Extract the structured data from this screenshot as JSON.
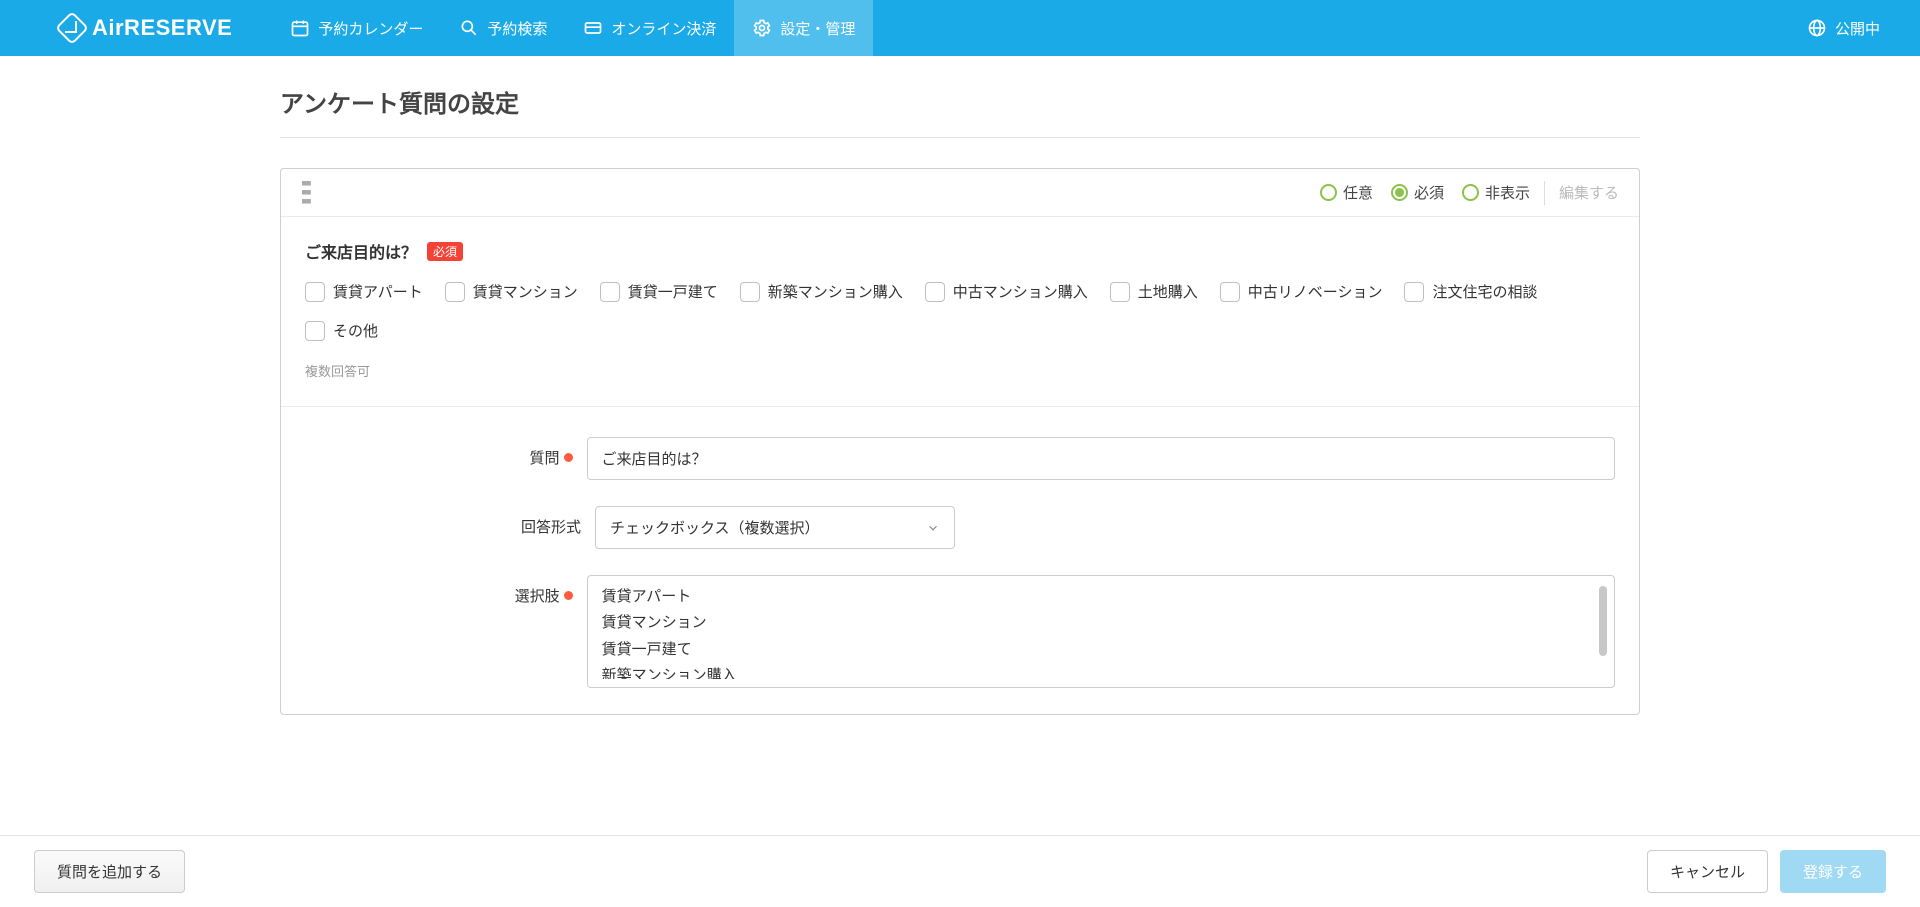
{
  "brand": "AirRESERVE",
  "nav": {
    "items": [
      {
        "label": "予約カレンダー"
      },
      {
        "label": "予約検索"
      },
      {
        "label": "オンライン決済"
      },
      {
        "label": "設定・管理"
      }
    ]
  },
  "status_label": "公開中",
  "page_title": "アンケート質問の設定",
  "card": {
    "radios": [
      {
        "label": "任意",
        "on": false
      },
      {
        "label": "必須",
        "on": true
      },
      {
        "label": "非表示",
        "on": false
      }
    ],
    "edit_label": "編集する",
    "question_title": "ご来店目的は？",
    "required_badge": "必須",
    "options": [
      "賃貸アパート",
      "賃貸マンション",
      "賃貸一戸建て",
      "新築マンション購入",
      "中古マンション購入",
      "土地購入",
      "中古リノベーション",
      "注文住宅の相談",
      "その他"
    ],
    "helper": "複数回答可"
  },
  "form": {
    "label_question": "質問",
    "label_answer_type": "回答形式",
    "label_choices": "選択肢",
    "question_value": "ご来店目的は？",
    "answer_type_value": "チェックボックス（複数選択）",
    "choices_text": "賃貸アパート\n賃貸マンション\n賃貸一戸建て\n新築マンション購入"
  },
  "footer": {
    "add_label": "質問を追加する",
    "cancel_label": "キャンセル",
    "submit_label": "登録する"
  }
}
